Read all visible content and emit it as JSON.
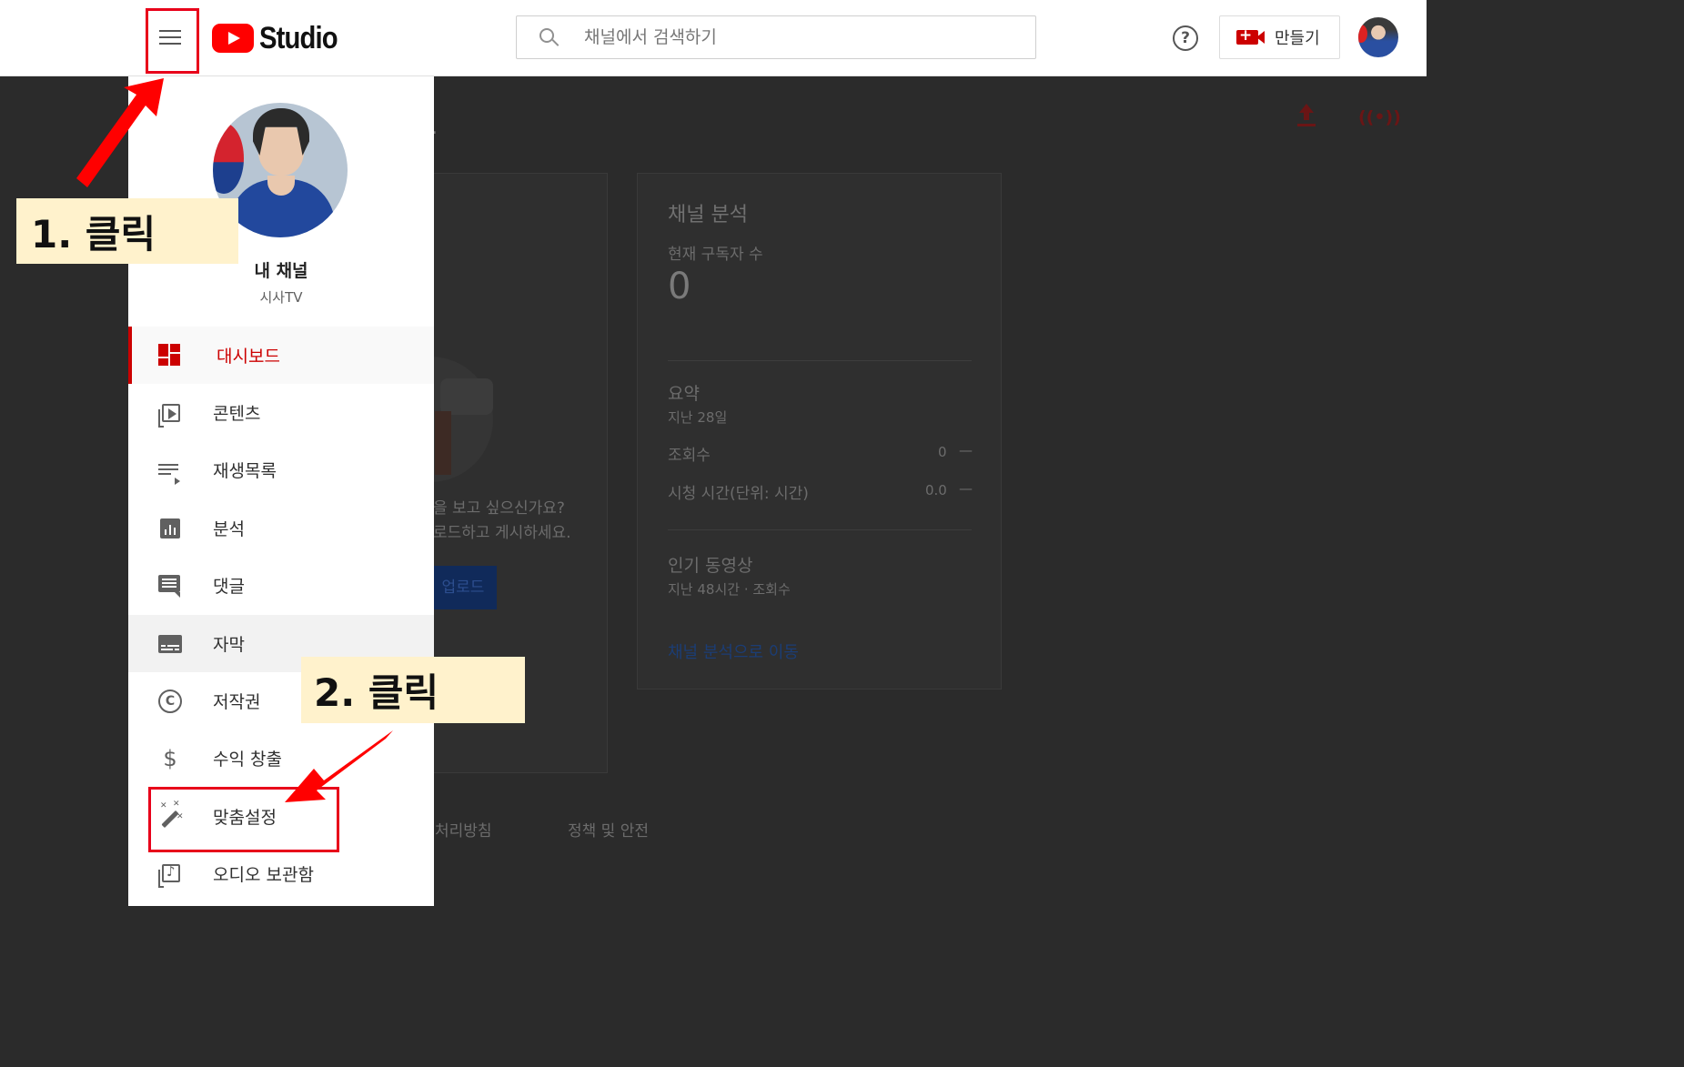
{
  "header": {
    "logo_text": "Studio",
    "search_placeholder": "채널에서 검색하기",
    "help_glyph": "?",
    "create_label": "만들기"
  },
  "channel": {
    "name": "내 채널",
    "subtitle": "시사TV"
  },
  "nav": {
    "items": [
      {
        "label": "대시보드",
        "icon": "dashboard-icon",
        "active": true
      },
      {
        "label": "콘텐츠",
        "icon": "content-icon"
      },
      {
        "label": "재생목록",
        "icon": "playlist-icon"
      },
      {
        "label": "분석",
        "icon": "analytics-icon"
      },
      {
        "label": "댓글",
        "icon": "comment-icon"
      },
      {
        "label": "자막",
        "icon": "subtitles-icon"
      },
      {
        "label": "저작권",
        "icon": "copyright-icon"
      },
      {
        "label": "수익 창출",
        "icon": "dollar-icon"
      },
      {
        "label": "맞춤설정",
        "icon": "magic-wand-icon"
      },
      {
        "label": "오디오 보관함",
        "icon": "audio-library-icon"
      }
    ]
  },
  "dashboard": {
    "dot": ".",
    "upload_prompt_line1": "을 보고 싶으신가요?",
    "upload_prompt_line2": "로드하고 게시하세요.",
    "upload_button": "업로드",
    "footer_link1": "처리방침",
    "footer_link2": "정책 및 안전",
    "analytics": {
      "title": "채널 분석",
      "subscribers_label": "현재 구독자 수",
      "subscribers_value": "0",
      "summary_title": "요약",
      "summary_period": "지난 28일",
      "views_label": "조회수",
      "views_value": "0",
      "views_trend": "—",
      "watch_label": "시청 시간(단위: 시간)",
      "watch_value": "0.0",
      "watch_trend": "—",
      "top_videos_title": "인기 동영상",
      "top_videos_sub": "지난 48시간 · 조회수",
      "link": "채널 분석으로 이동"
    }
  },
  "annotations": {
    "step1": "1. 클릭",
    "step2": "2. 클릭",
    "highlight_color": "#e8001a",
    "note_bg": "#fff2cc"
  },
  "colors": {
    "brand_red": "#ff0000",
    "active_red": "#cc0000",
    "overlay_bg": "#2b2b2b"
  }
}
